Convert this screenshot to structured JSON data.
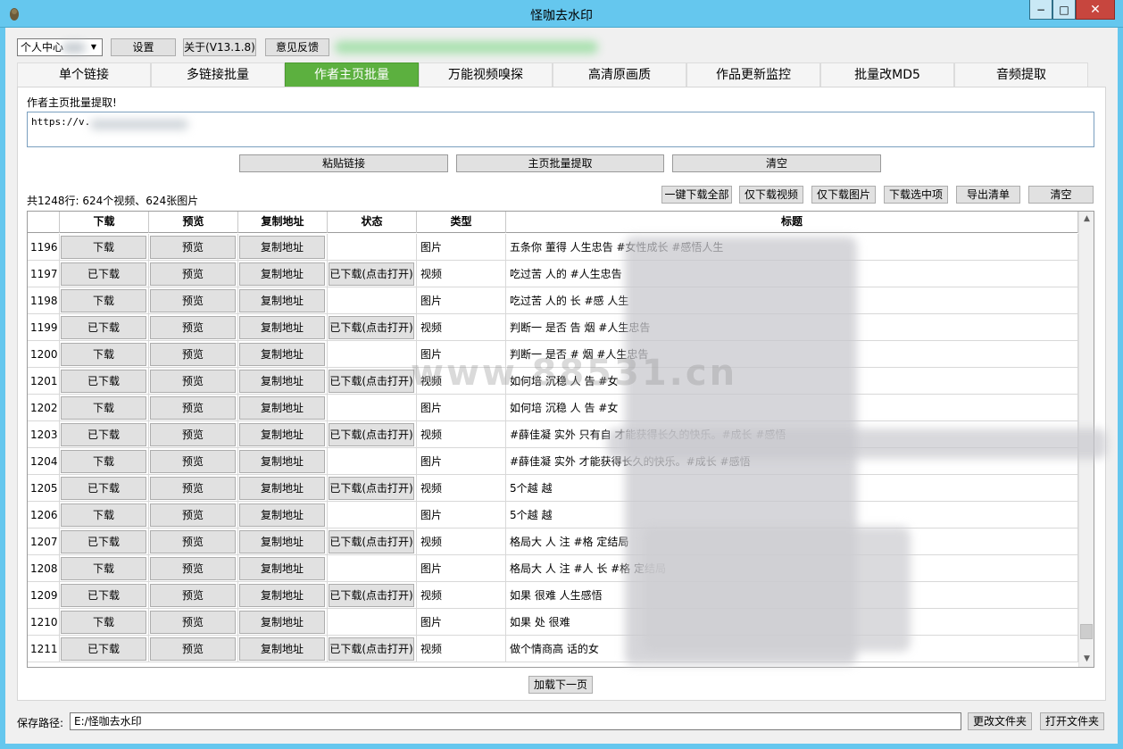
{
  "window": {
    "title": "怪咖去水印",
    "minimize": "−",
    "maximize": "□",
    "close": "✕"
  },
  "toolbar": {
    "profile_select": "个人中心",
    "settings": "设置",
    "about": "关于(V13.1.8)",
    "feedback": "意见反馈"
  },
  "tabs": [
    {
      "label": "单个链接",
      "active": false
    },
    {
      "label": "多链接批量",
      "active": false
    },
    {
      "label": "作者主页批量",
      "active": true
    },
    {
      "label": "万能视频嗅探",
      "active": false
    },
    {
      "label": "高清原画质",
      "active": false
    },
    {
      "label": "作品更新监控",
      "active": false
    },
    {
      "label": "批量改MD5",
      "active": false
    },
    {
      "label": "音频提取",
      "active": false
    }
  ],
  "panel": {
    "heading": "作者主页批量提取!",
    "url_value": "https://v.",
    "paste_button": "粘贴链接",
    "extract_button": "主页批量提取",
    "clear_button": "清空",
    "summary": "共1248行: 624个视频、624张图片",
    "download_all": "一键下载全部",
    "download_video": "仅下载视频",
    "download_image": "仅下载图片",
    "download_selected": "下载选中项",
    "export_list": "导出清单",
    "clear_list": "清空",
    "load_next": "加载下一页"
  },
  "table": {
    "headers": [
      "",
      "下载",
      "预览",
      "复制地址",
      "状态",
      "类型",
      "标题"
    ],
    "rows": [
      {
        "num": "1196",
        "download": "下载",
        "preview": "预览",
        "copy": "复制地址",
        "status": "",
        "type": "图片",
        "title": "五条你 董得 人生忠告 #女性成长 #感悟人生"
      },
      {
        "num": "1197",
        "download": "已下载",
        "preview": "预览",
        "copy": "复制地址",
        "status": "已下载(点击打开)",
        "type": "视频",
        "title": "吃过苦 人的 #人生忠告"
      },
      {
        "num": "1198",
        "download": "下载",
        "preview": "预览",
        "copy": "复制地址",
        "status": "",
        "type": "图片",
        "title": "吃过苦 人的 长 #感 人生"
      },
      {
        "num": "1199",
        "download": "已下载",
        "preview": "预览",
        "copy": "复制地址",
        "status": "已下载(点击打开)",
        "type": "视频",
        "title": "判断一 是否 告 烟 #人生忠告"
      },
      {
        "num": "1200",
        "download": "下载",
        "preview": "预览",
        "copy": "复制地址",
        "status": "",
        "type": "图片",
        "title": "判断一 是否 # 烟 #人生忠告"
      },
      {
        "num": "1201",
        "download": "已下载",
        "preview": "预览",
        "copy": "复制地址",
        "status": "已下载(点击打开)",
        "type": "视频",
        "title": "如何培 沉稳 人 告 #女"
      },
      {
        "num": "1202",
        "download": "下载",
        "preview": "预览",
        "copy": "复制地址",
        "status": "",
        "type": "图片",
        "title": "如何培 沉稳 人 告 #女"
      },
      {
        "num": "1203",
        "download": "已下载",
        "preview": "预览",
        "copy": "复制地址",
        "status": "已下载(点击打开)",
        "type": "视频",
        "title": "#薛佳凝 实外 只有自 才能获得长久的快乐。#成长 #感悟"
      },
      {
        "num": "1204",
        "download": "下载",
        "preview": "预览",
        "copy": "复制地址",
        "status": "",
        "type": "图片",
        "title": "#薛佳凝 实外 才能获得长久的快乐。#成长 #感悟"
      },
      {
        "num": "1205",
        "download": "已下载",
        "preview": "预览",
        "copy": "复制地址",
        "status": "已下载(点击打开)",
        "type": "视频",
        "title": "5个越 越"
      },
      {
        "num": "1206",
        "download": "下载",
        "preview": "预览",
        "copy": "复制地址",
        "status": "",
        "type": "图片",
        "title": "5个越 越"
      },
      {
        "num": "1207",
        "download": "已下载",
        "preview": "预览",
        "copy": "复制地址",
        "status": "已下载(点击打开)",
        "type": "视频",
        "title": "格局大 人 注 #格 定结局"
      },
      {
        "num": "1208",
        "download": "下载",
        "preview": "预览",
        "copy": "复制地址",
        "status": "",
        "type": "图片",
        "title": "格局大 人 注 #人 长 #格 定结局"
      },
      {
        "num": "1209",
        "download": "已下载",
        "preview": "预览",
        "copy": "复制地址",
        "status": "已下载(点击打开)",
        "type": "视频",
        "title": "如果 很难 人生感悟"
      },
      {
        "num": "1210",
        "download": "下载",
        "preview": "预览",
        "copy": "复制地址",
        "status": "",
        "type": "图片",
        "title": "如果 处 很难"
      },
      {
        "num": "1211",
        "download": "已下载",
        "preview": "预览",
        "copy": "复制地址",
        "status": "已下载(点击打开)",
        "type": "视频",
        "title": "做个情商高 话的女"
      }
    ]
  },
  "watermark": "www.88531.cn",
  "footer": {
    "save_path_label": "保存路径:",
    "save_path_value": "E:/怪咖去水印",
    "change_folder": "更改文件夹",
    "open_folder": "打开文件夹"
  },
  "colors": {
    "titlebar": "#65c7ee",
    "active_tab": "#5cb03f",
    "close_button": "#c7463e"
  }
}
